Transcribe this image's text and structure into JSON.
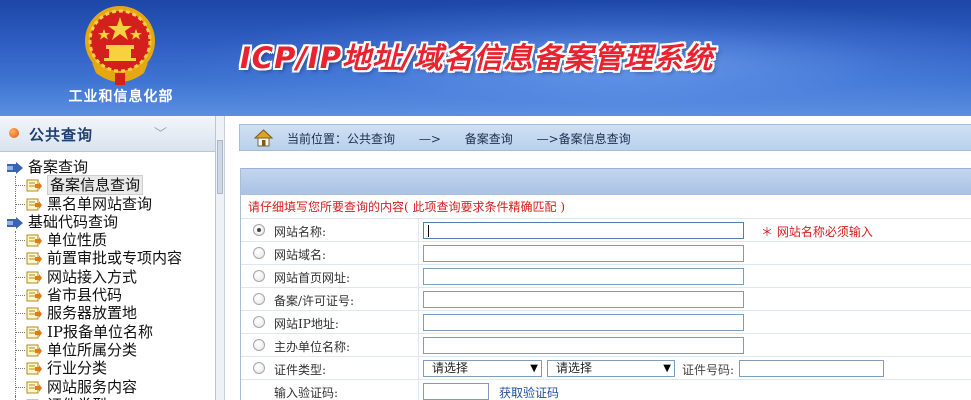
{
  "header": {
    "ministry_name": "工业和信息化部",
    "system_title": "ICP/IP地址/域名信息备案管理系统"
  },
  "sidebar": {
    "title": "公共查询",
    "tree": [
      {
        "type": "group",
        "label": "备案查询"
      },
      {
        "type": "leaf",
        "label": "备案信息查询",
        "selected": true
      },
      {
        "type": "leaf",
        "label": "黑名单网站查询"
      },
      {
        "type": "group",
        "label": "基础代码查询"
      },
      {
        "type": "leaf",
        "label": "单位性质"
      },
      {
        "type": "leaf",
        "label": "前置审批或专项内容"
      },
      {
        "type": "leaf",
        "label": "网站接入方式"
      },
      {
        "type": "leaf",
        "label": "省市县代码"
      },
      {
        "type": "leaf",
        "label": "服务器放置地"
      },
      {
        "type": "leaf",
        "label": "IP报备单位名称"
      },
      {
        "type": "leaf",
        "label": "单位所属分类"
      },
      {
        "type": "leaf",
        "label": "行业分类"
      },
      {
        "type": "leaf",
        "label": "网站服务内容"
      },
      {
        "type": "leaf",
        "label": "证件类型"
      }
    ]
  },
  "breadcrumb": {
    "prefix": "当前位置：公共查询",
    "sep1": "—>",
    "item2": "备案查询",
    "item3": "—>备案信息查询"
  },
  "form": {
    "notice": "请仔细填写您所要查询的内容( 此项查询要求条件精确匹配 )",
    "fields": [
      {
        "label": "网站名称:",
        "value": "",
        "selected": true,
        "hint": "＊ 网站名称必须输入"
      },
      {
        "label": "网站域名:",
        "value": ""
      },
      {
        "label": "网站首页网址:",
        "value": ""
      },
      {
        "label": "备案/许可证号:",
        "value": ""
      },
      {
        "label": "网站IP地址:",
        "value": ""
      },
      {
        "label": "主办单位名称:",
        "value": ""
      }
    ],
    "cert": {
      "label": "证件类型:",
      "select1": "请选择",
      "select2": "请选择",
      "number_label": "证件号码:",
      "number_value": ""
    },
    "captcha": {
      "label": "输入验证码:",
      "value": "",
      "get_code": "获取验证码"
    }
  },
  "colors": {
    "header_blue": "#2d5cc0",
    "title_red": "#e8232f",
    "notice_red": "#d42020"
  }
}
